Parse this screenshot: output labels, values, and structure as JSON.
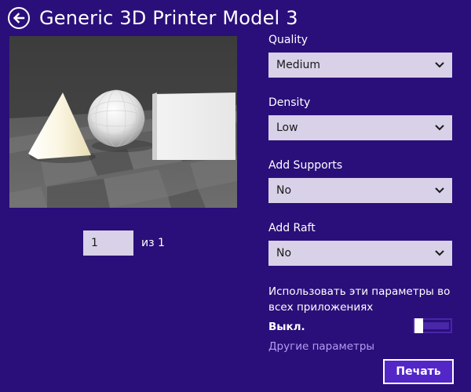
{
  "header": {
    "title": "Generic 3D Printer Model 3",
    "back_icon": "back-arrow-circle-icon"
  },
  "preview": {
    "page_value": "1",
    "page_of": "из 1"
  },
  "settings": {
    "quality": {
      "label": "Quality",
      "value": "Medium"
    },
    "density": {
      "label": "Density",
      "value": "Low"
    },
    "supports": {
      "label": "Add Supports",
      "value": "No"
    },
    "raft": {
      "label": "Add Raft",
      "value": "No"
    },
    "apply_all_text": "Использовать эти параметры во всех приложениях",
    "toggle_state": "Выкл.",
    "more_link": "Другие параметры",
    "print_label": "Печать"
  },
  "colors": {
    "background": "#2a0f7a",
    "field_bg": "#d8d1e8",
    "link": "#b49cf0",
    "button": "#5326c8",
    "toggle": "#4a26a8"
  }
}
